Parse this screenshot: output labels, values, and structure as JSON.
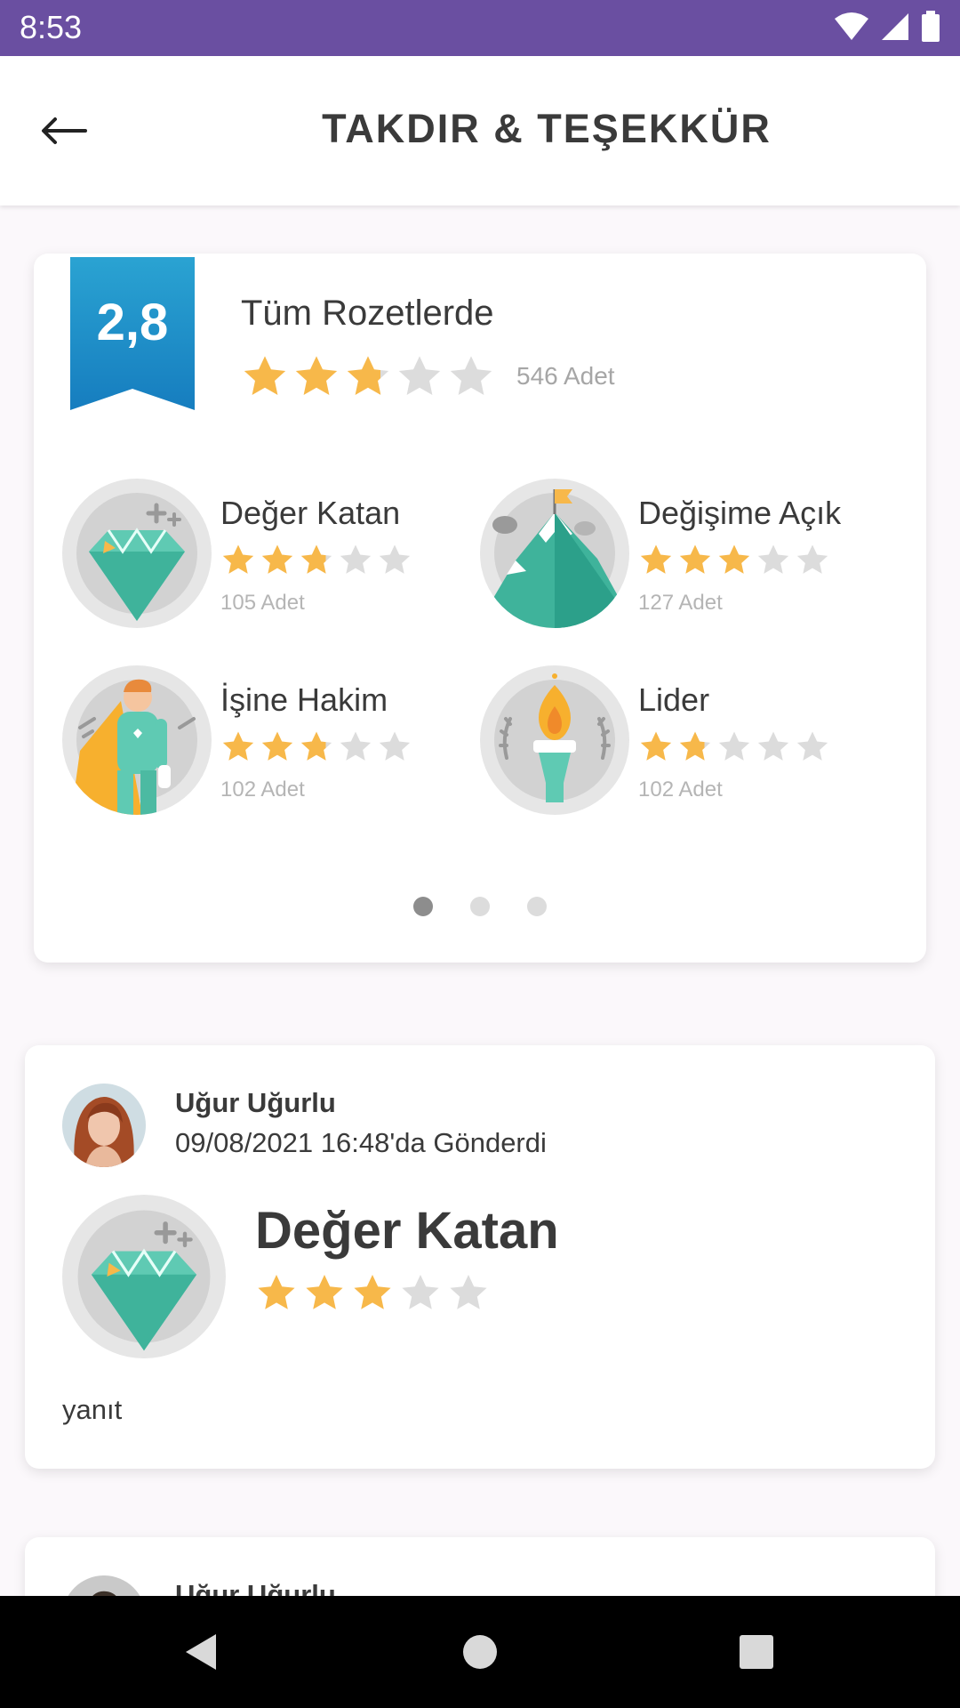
{
  "status_bar": {
    "time": "8:53",
    "icons": [
      "wifi-icon",
      "signal-icon",
      "battery-icon"
    ]
  },
  "header": {
    "title": "TAKDIR & TEŞEKKÜR",
    "back_icon": "arrow-left-icon"
  },
  "summary": {
    "score": "2,8",
    "title": "Tüm Rozetlerde",
    "rating": 2.8,
    "count": "546 Adet",
    "badges": [
      {
        "name": "Değer Katan",
        "rating": 2.8,
        "count": "105 Adet",
        "icon": "diamond-icon"
      },
      {
        "name": "Değişime Açık",
        "rating": 3,
        "count": "127 Adet",
        "icon": "mountain-flag-icon"
      },
      {
        "name": "İşine Hakim",
        "rating": 2.8,
        "count": "102 Adet",
        "icon": "superhero-icon"
      },
      {
        "name": "Lider",
        "rating": 1.8,
        "count": "102 Adet",
        "icon": "torch-icon"
      }
    ],
    "pager": {
      "pages": 3,
      "active": 0
    }
  },
  "feed": [
    {
      "user": "Uğur Uğurlu",
      "sent": "09/08/2021 16:48'da Gönderdi",
      "badge": "Değer Katan",
      "rating": 3,
      "comment": "yanıt"
    },
    {
      "user": "Uğur Uğurlu"
    }
  ],
  "colors": {
    "status_bar": "#6a4fa1",
    "ribbon": "#1a8fc9",
    "star_filled": "#f7b84a",
    "star_empty": "#dcdcdc",
    "teal": "#3fbfa5"
  }
}
